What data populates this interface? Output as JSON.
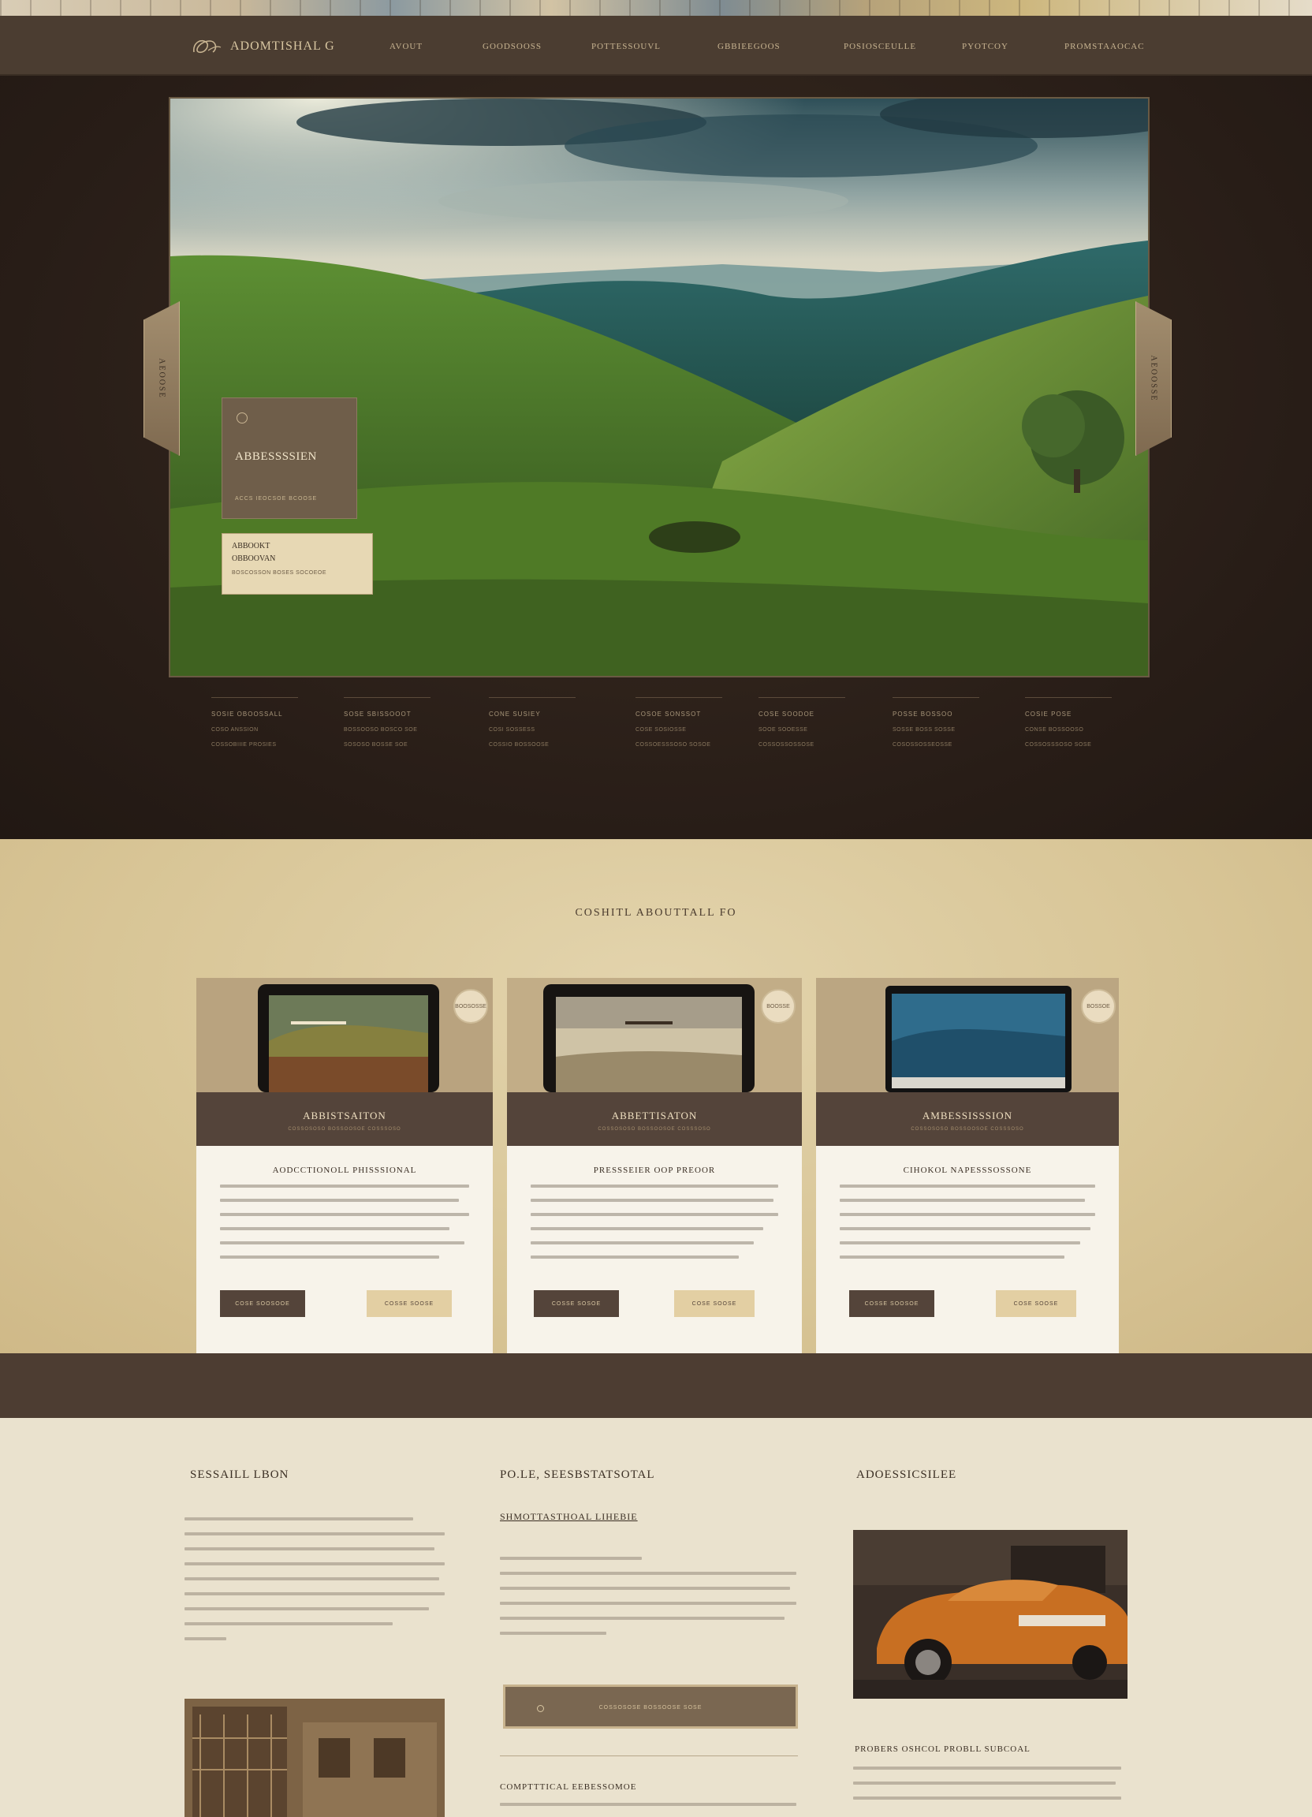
{
  "nav": {
    "logo_text": "ADOMTISHAL G",
    "items": [
      "AVOUT",
      "GOODSOOSS",
      "POTTESSOUVL",
      "GBBIEEGOOS",
      "POSIOSCEULLE",
      "PYOTCOY",
      "PROMSTAAOCAC"
    ]
  },
  "hero": {
    "side_tab_left": "AEOOSE",
    "side_tab_right": "AEOOSSE",
    "card_title": "ABBESSSSIEN",
    "card_sub": "ACCS IEOCSOE BCOOSE",
    "card2_line1": "ABBOOKT",
    "card2_line2": "OBBOOVAN",
    "card2_line3": "BOSCOSSON BOSES SOCOEOE",
    "info": [
      {
        "h": "SOSIE OBOOSSALL",
        "t1": "COSO ANSSION",
        "t2": "COSSOBIIIE PROSIES"
      },
      {
        "h": "SOSE SBISSOOOT",
        "t1": "BOSSOOSO BOSCO SOE",
        "t2": "SOSOSO BOSSE SOE"
      },
      {
        "h": "CONE SUSIEY",
        "t1": "COSI SOSSESS",
        "t2": "COSSIO BOSSOOSE"
      },
      {
        "h": "COSOE SONSSOT",
        "t1": "COSE SOSIOSSE",
        "t2": "COSSOESSSOSO SOSOE"
      },
      {
        "h": "COSE SOODOE",
        "t1": "SOOE SOOESSE",
        "t2": "COSSOSSOSSOSE"
      },
      {
        "h": "POSSE BOSSOO",
        "t1": "SOSSE BOSS SOSSE",
        "t2": "COSOSSOSSEOSSE"
      },
      {
        "h": "COSIE POSE",
        "t1": "CONSE BOSSOOSO",
        "t2": "COSSOSSSOSO SOSE"
      }
    ]
  },
  "about": {
    "title": "COSHITL ABOUTTALL FO",
    "cards": [
      {
        "badge": "BOOSOSSE",
        "band_title": "ABBISTSAITON",
        "band_sub": "COSSOSOSO BOSSOOSOE COSSSOSO",
        "head": "AODCCTIONOLL PHISSSIONAL",
        "btn_dark": "COSE SOOSOOE",
        "btn_light": "COSSE SOOSE"
      },
      {
        "badge": "BOOSSE",
        "band_title": "ABBETTISATON",
        "band_sub": "COSSOSOSO BOSSOOSOE COSSSOSO",
        "head": "PRESSSEIER OOP PREOOR",
        "btn_dark": "COSSE SOSOE",
        "btn_light": "COSE SOOSE"
      },
      {
        "badge": "BOSSOE",
        "band_title": "AMBESSISSSION",
        "band_sub": "COSSOSOSO BOSSOOSOE COSSSOSO",
        "head": "CIHOKOL NAPESSSOSSONE",
        "btn_dark": "COSSE SOOSOE",
        "btn_light": "COSE SOOSE"
      }
    ]
  },
  "bottom": {
    "col1_title": "SESSAILL LBON",
    "col2_title": "PO.LE, SEESBSTATSOTAL",
    "col2_sub": "SHMOTTASTHOAL LIHEBIE",
    "col2_cta": "COSSOSOSE BOSSOOSE SOSE",
    "col2_footer": "COMPTTTICAL EEBESSOMOE",
    "col3_title": "ADOESSICSILEE",
    "col3_sub": "PROBERS OSHCOL PROBLL SUBCOAL"
  }
}
